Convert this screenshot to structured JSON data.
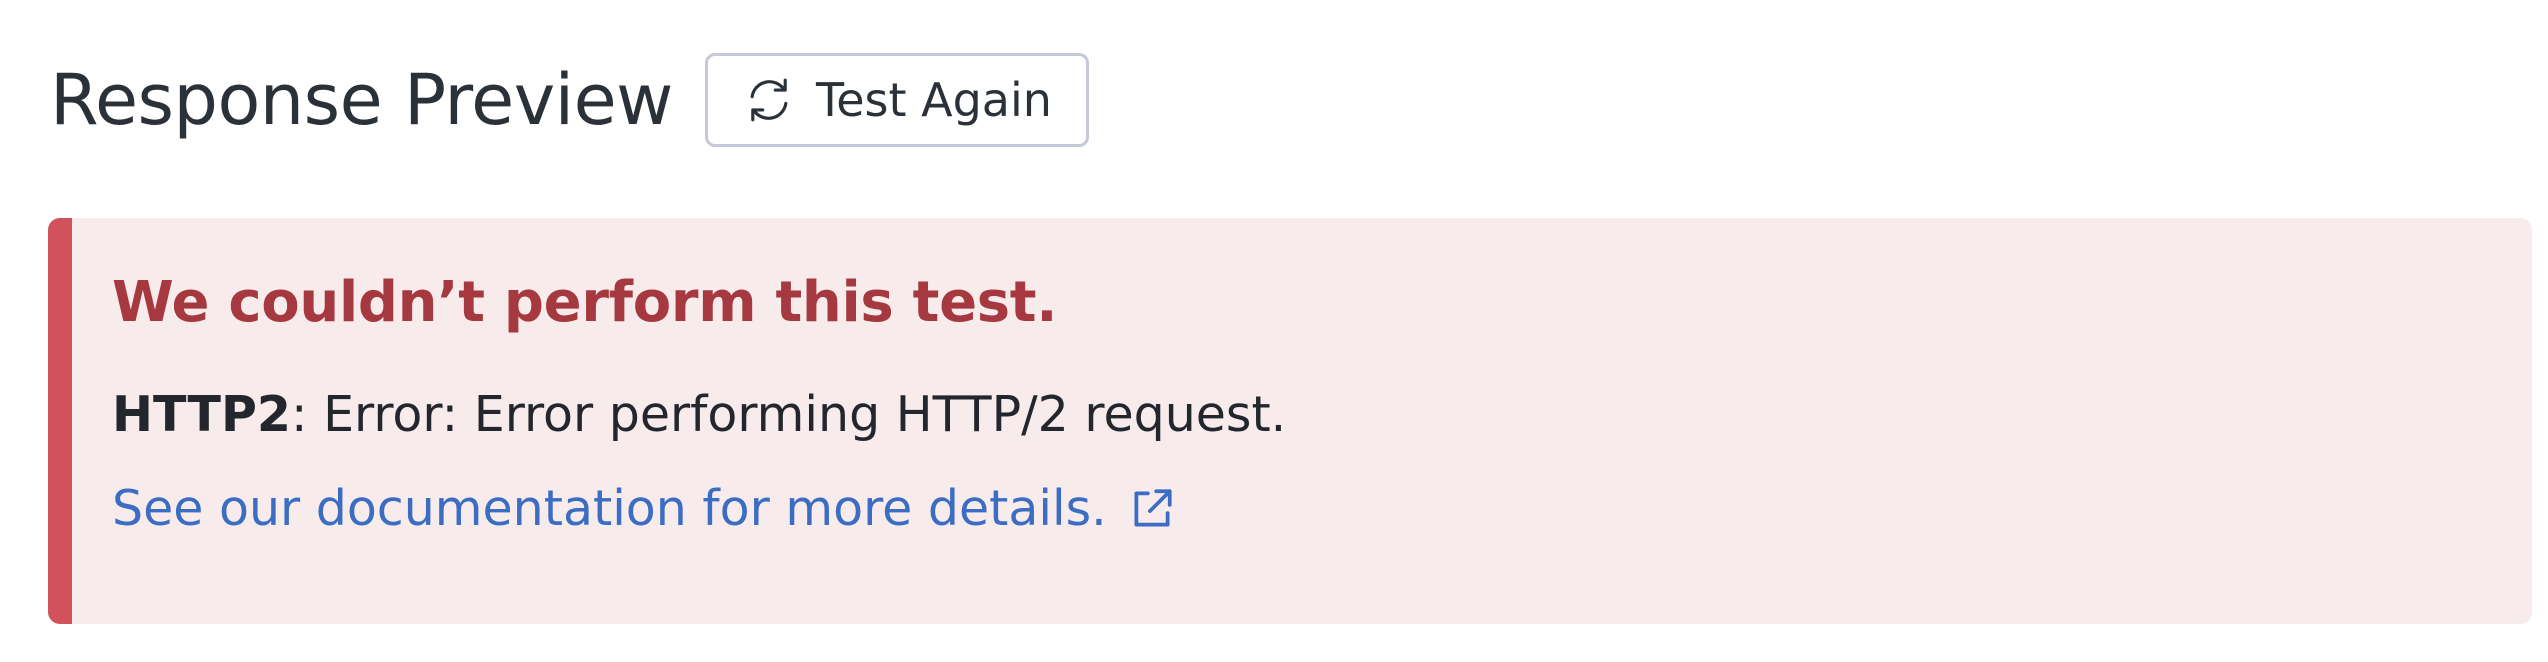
{
  "header": {
    "title": "Response Preview",
    "test_again_label": "Test Again",
    "test_again_icon": "refresh-icon"
  },
  "alert": {
    "title": "We couldn’t perform this test.",
    "error_code": "HTTP2",
    "error_message": ": Error: Error performing HTTP/2 request.",
    "link_text": "See our documentation for more details.",
    "link_icon": "external-link-icon"
  },
  "colors": {
    "alert_background": "#f7ebec",
    "alert_stripe": "#d1525a",
    "alert_title": "#a6383f",
    "link": "#3b6dc2",
    "button_border": "#c6c9d8",
    "text": "#2b3138"
  }
}
